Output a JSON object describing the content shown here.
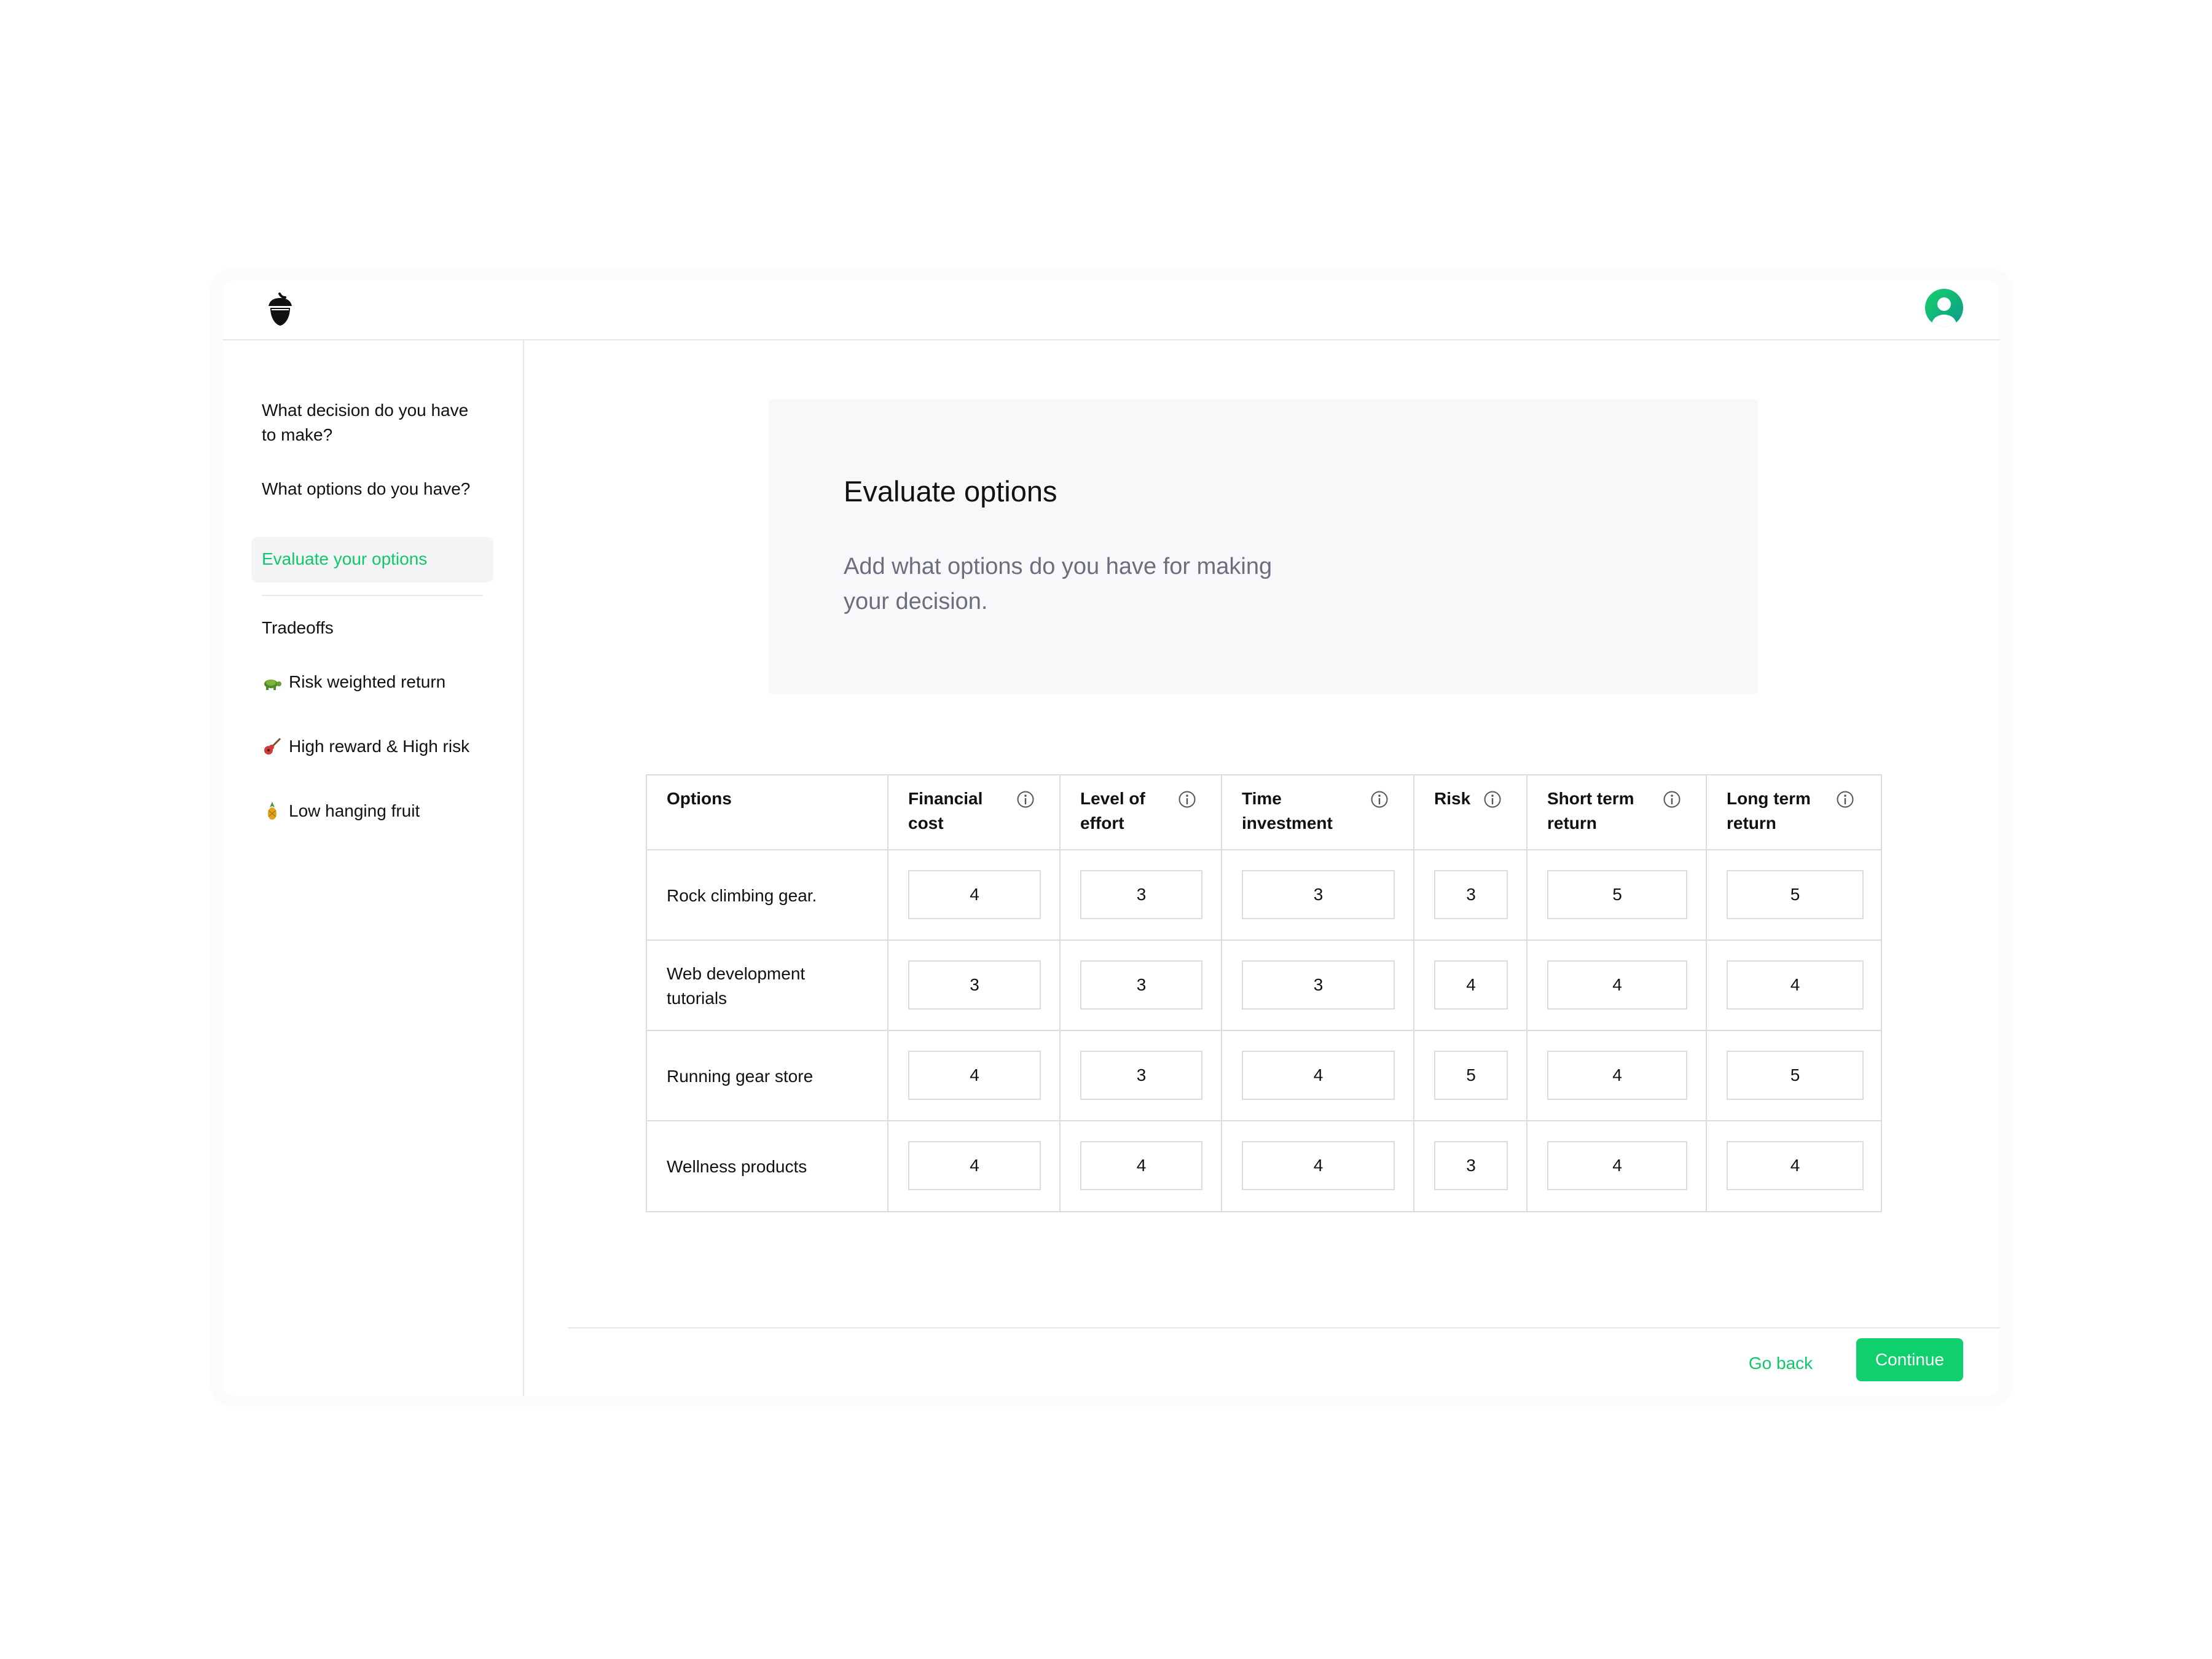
{
  "colors": {
    "accent": "#0fc86b",
    "button": "#0fd06d",
    "muted": "#6b6f7d",
    "border": "#dcdcdc"
  },
  "header": {
    "logo_icon": "acorn-icon",
    "avatar_icon": "user-avatar-icon"
  },
  "sidebar": {
    "steps": [
      {
        "label": "What decision do you have to make?"
      },
      {
        "label": "What options do you have?"
      },
      {
        "label": "Evaluate your options",
        "active": true
      }
    ],
    "tradeoffs_label": "Tradeoffs",
    "tradeoffs": [
      {
        "label": "Risk weighted return",
        "icon": "turtle-icon"
      },
      {
        "label": "High reward & High risk",
        "icon": "guitar-icon"
      },
      {
        "label": "Low hanging fruit",
        "icon": "pineapple-icon"
      }
    ]
  },
  "hero": {
    "title": "Evaluate options",
    "subtitle": "Add what options do you have for making your decision."
  },
  "table": {
    "columns": [
      {
        "label": "Options"
      },
      {
        "label": "Financial cost",
        "info_icon": "info-icon"
      },
      {
        "label": "Level of effort",
        "info_icon": "info-icon"
      },
      {
        "label": "Time investment",
        "info_icon": "info-icon"
      },
      {
        "label": "Risk",
        "info_icon": "info-icon"
      },
      {
        "label": "Short term return",
        "info_icon": "info-icon"
      },
      {
        "label": "Long term return",
        "info_icon": "info-icon"
      }
    ],
    "rows": [
      {
        "option": "Rock climbing gear.",
        "scores": [
          "4",
          "3",
          "3",
          "3",
          "5",
          "5"
        ]
      },
      {
        "option": "Web development tutorials",
        "scores": [
          "3",
          "3",
          "3",
          "4",
          "4",
          "4"
        ]
      },
      {
        "option": "Running gear store",
        "scores": [
          "4",
          "3",
          "4",
          "5",
          "4",
          "5"
        ]
      },
      {
        "option": "Wellness products",
        "scores": [
          "4",
          "4",
          "4",
          "3",
          "4",
          "4"
        ]
      }
    ]
  },
  "footer": {
    "back_label": "Go back",
    "continue_label": "Continue"
  }
}
